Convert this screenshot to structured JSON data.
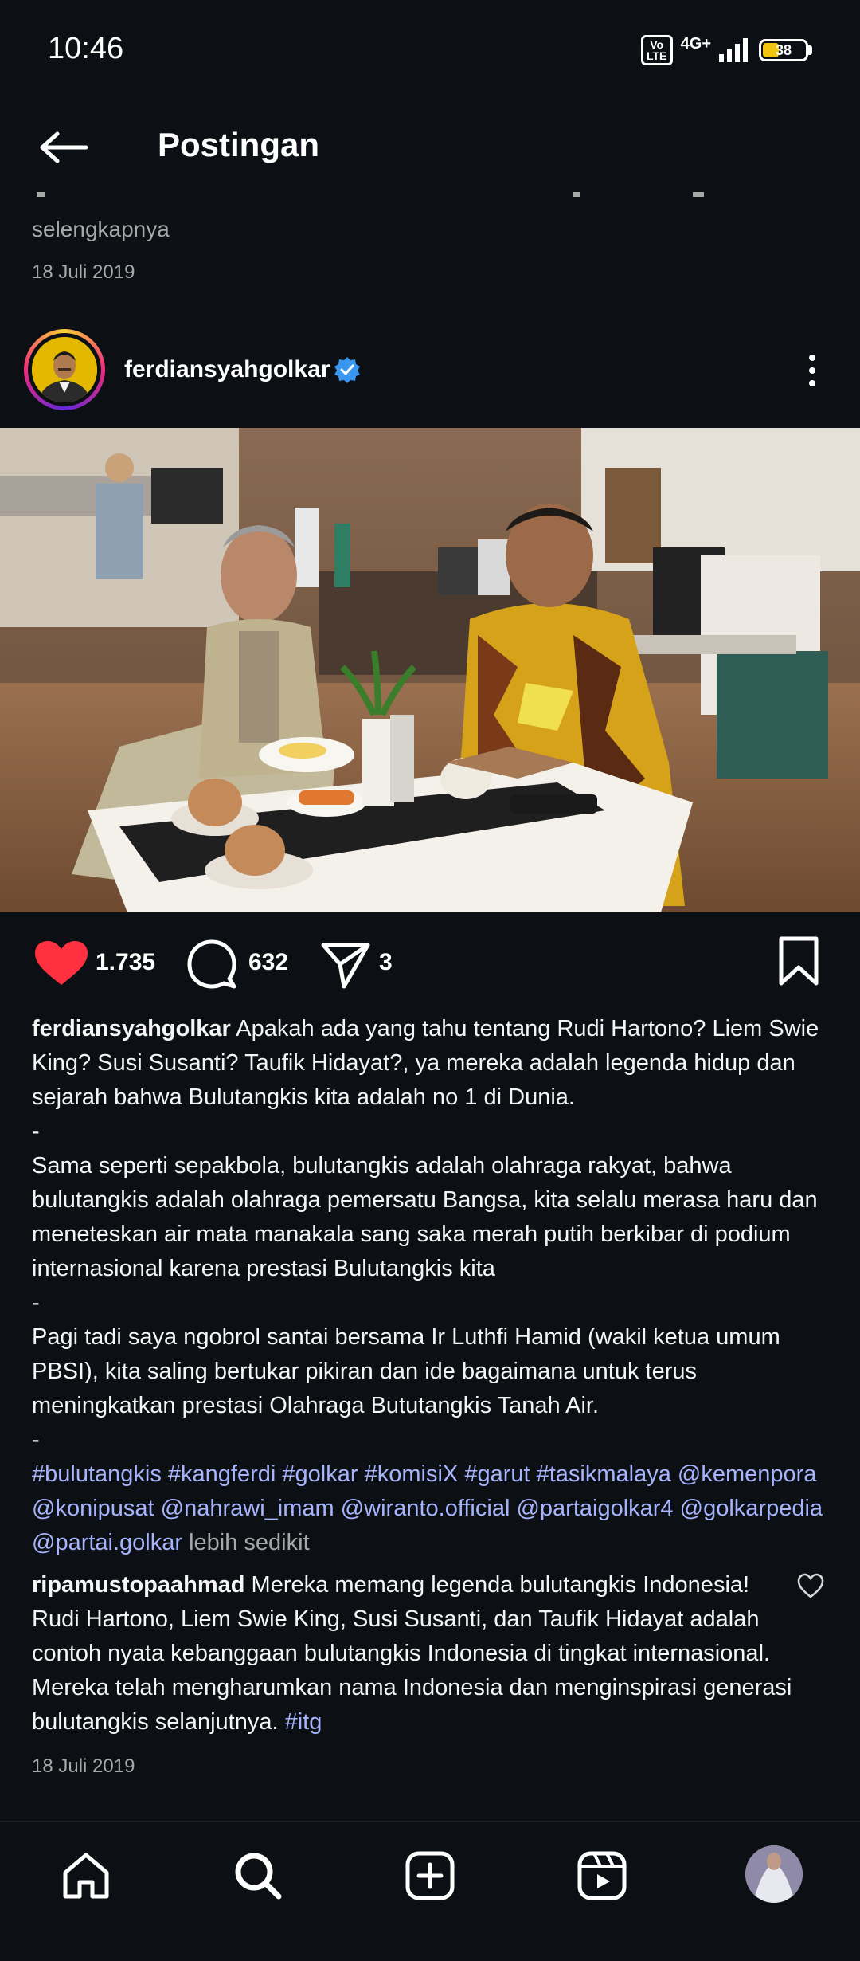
{
  "status_bar": {
    "time": "10:46",
    "volte": "Vo LTE",
    "network": "4G+",
    "battery": "38",
    "battery_level": 0.38
  },
  "header": {
    "title": "Postingan",
    "back_icon": "arrow-left-icon"
  },
  "previous_post": {
    "more_label": "selengkapnya",
    "date": "18 Juli 2019"
  },
  "post": {
    "username": "ferdiansyahgolkar",
    "verified": true,
    "actions": {
      "likes": "1.735",
      "comments": "632",
      "shares": "3"
    },
    "caption": {
      "username": "ferdiansyahgolkar",
      "para1": " Apakah ada yang tahu tentang Rudi Hartono? Liem Swie King? Susi Susanti? Taufik Hidayat?, ya mereka adalah legenda hidup dan sejarah bahwa Bulutangkis kita adalah no 1 di Dunia.",
      "sep1": "-",
      "para2": "Sama seperti sepakbola, bulutangkis adalah olahraga rakyat, bahwa bulutangkis adalah olahraga pemersatu Bangsa, kita selalu merasa haru dan meneteskan air mata manakala sang saka merah putih berkibar di podium internasional karena prestasi Bulutangkis kita",
      "sep2": "-",
      "para3": "Pagi tadi saya ngobrol santai bersama Ir Luthfi Hamid (wakil ketua umum PBSI), kita saling bertukar pikiran dan ide bagaimana untuk terus meningkatkan prestasi Olahraga Bututangkis Tanah Air.",
      "sep3": "-",
      "tags": [
        "#bulutangkis",
        "#kangferdi",
        "#golkar",
        "#komisiX",
        "#garut",
        "#tasikmalaya",
        "@kemenpora",
        "@konipusat",
        "@nahrawi_imam",
        "@wiranto.official",
        "@partaigolkar4",
        "@golkarpedia",
        "@partai.golkar"
      ],
      "less_label": "lebih sedikit"
    },
    "top_comment": {
      "username": "ripamustopaahmad",
      "text": " Mereka memang legenda bulutangkis Indonesia! Rudi Hartono, Liem Swie King, Susi Susanti, dan Taufik Hidayat adalah contoh nyata kebanggaan bulutangkis Indonesia di tingkat internasional. Mereka telah mengharumkan nama Indonesia dan menginspirasi generasi bulutangkis selanjutnya. ",
      "tag": "#itg"
    },
    "date": "18 Juli 2019"
  },
  "bottom_nav": {
    "items": [
      "home-icon",
      "search-icon",
      "create-post-icon",
      "reels-icon",
      "profile-avatar"
    ]
  },
  "colors": {
    "background": "#0c1014",
    "like_red": "#ff3040",
    "link": "#a5b4fc",
    "muted": "#a8a8a8",
    "verified_blue": "#3897f0"
  }
}
